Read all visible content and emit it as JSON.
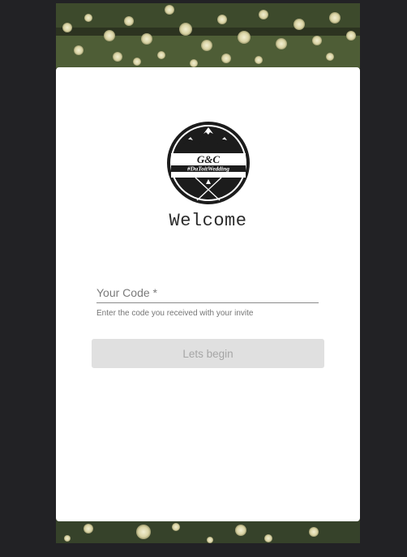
{
  "logo": {
    "initials": "G&C",
    "hashtag": "#DuToitWedding",
    "icon": "mountain-crossed-arrows-emblem-icon"
  },
  "welcome": {
    "title": "Welcome"
  },
  "form": {
    "code_placeholder": "Your Code *",
    "code_value": "",
    "helper_text": "Enter the code you received with your invite",
    "submit_label": "Lets begin"
  },
  "colors": {
    "page_background": "#222225",
    "card_background": "#ffffff",
    "button_background": "#e0e0e0",
    "button_text": "#a6a6a6"
  }
}
